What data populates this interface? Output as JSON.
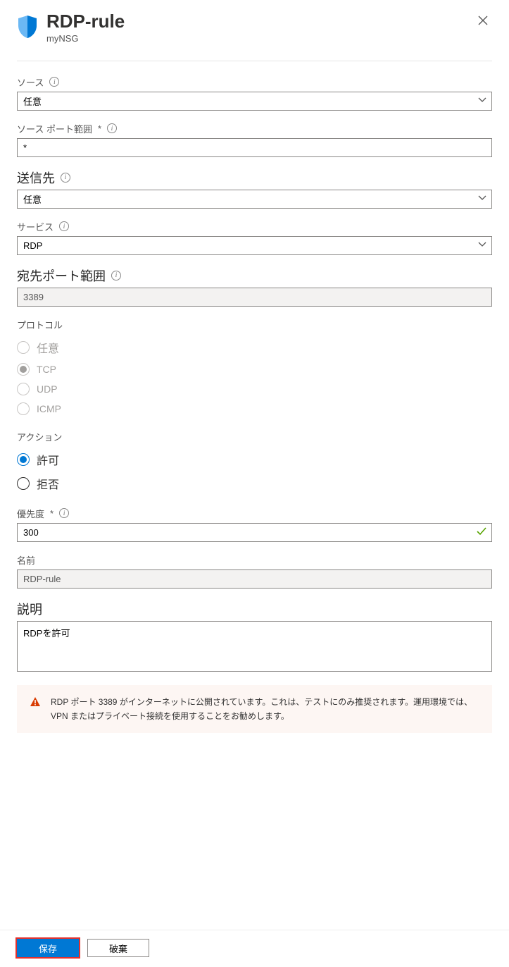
{
  "header": {
    "title": "RDP-rule",
    "subtitle": "myNSG"
  },
  "fields": {
    "source": {
      "label": "ソース",
      "value": "任意"
    },
    "source_port": {
      "label": "ソース ポート範囲",
      "value": "*",
      "required": "*"
    },
    "destination": {
      "label": "送信先",
      "value": "任意"
    },
    "service": {
      "label": "サービス",
      "value": "RDP"
    },
    "dest_port": {
      "label": "宛先ポート範囲",
      "value": "3389"
    },
    "protocol": {
      "label": "プロトコル",
      "options": {
        "any": "任意",
        "tcp": "TCP",
        "udp": "UDP",
        "icmp": "ICMP"
      }
    },
    "action": {
      "label": "アクション",
      "options": {
        "allow": "許可",
        "deny": "拒否"
      }
    },
    "priority": {
      "label": "優先度",
      "value": "300",
      "required": "*"
    },
    "name": {
      "label": "名前",
      "value": "RDP-rule"
    },
    "description": {
      "label": "説明",
      "value": "RDPを許可"
    }
  },
  "warning": "RDP ポート 3389 がインターネットに公開されています。これは、テストにのみ推奨されます。運用環境では、VPN またはプライベート接続を使用することをお勧めします。",
  "footer": {
    "save": "保存",
    "discard": "破棄"
  }
}
